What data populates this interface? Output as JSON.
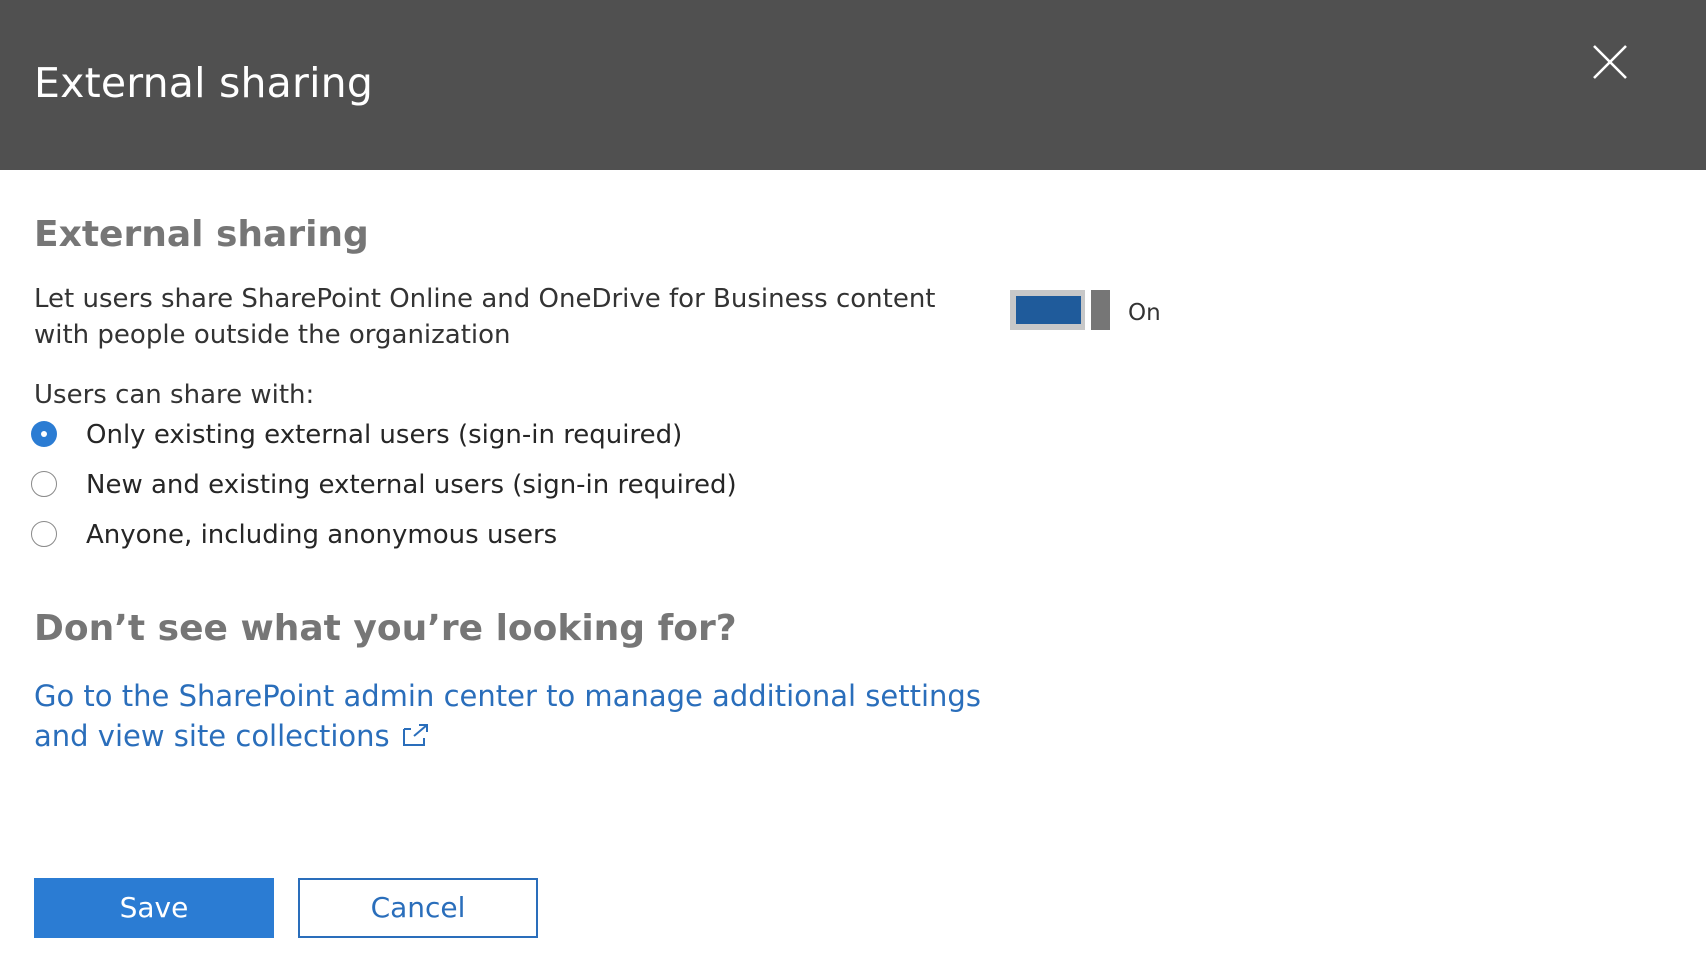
{
  "panel": {
    "title": "External sharing",
    "close_icon": "close-icon"
  },
  "external_sharing": {
    "heading": "External sharing",
    "description": "Let users share SharePoint Online and OneDrive for Business content with people outside the organization",
    "toggle": {
      "state": true,
      "label": "On"
    },
    "share_with_label": "Users can share with:",
    "options": [
      {
        "label": "Only existing external users (sign-in required)",
        "selected": true
      },
      {
        "label": "New and existing external users (sign-in required)",
        "selected": false
      },
      {
        "label": "Anyone, including anonymous users",
        "selected": false
      }
    ]
  },
  "more": {
    "heading": "Don’t see what you’re looking for?",
    "link_text": "Go to the SharePoint admin center to manage additional settings and view site collections",
    "link_icon": "external-link-icon"
  },
  "buttons": {
    "save_label": "Save",
    "cancel_label": "Cancel"
  },
  "colors": {
    "header_bg": "#505050",
    "accent": "#2b7cd3",
    "toggle_on": "#1f5b9b",
    "link": "#2a6ebb"
  }
}
